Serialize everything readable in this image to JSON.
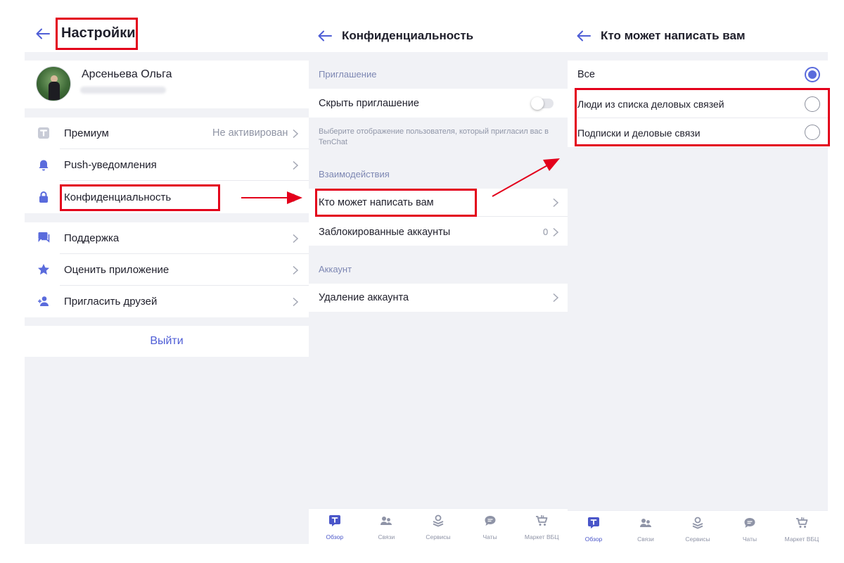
{
  "colors": {
    "accent": "#5a6bdc",
    "highlight": "#e3001b",
    "section": "#7d87b3",
    "background": "#f1f2f6"
  },
  "settings": {
    "title": "Настройки",
    "profile": {
      "name": "Арсеньева Ольга"
    },
    "items": [
      {
        "label": "Премиум",
        "value": "Не активирован",
        "icon": "premium-t-icon"
      },
      {
        "label": "Push-уведомления",
        "icon": "bell-icon"
      },
      {
        "label": "Конфиденциальность",
        "icon": "lock-icon"
      },
      {
        "label": "Поддержка",
        "icon": "chat-icon"
      },
      {
        "label": "Оценить приложение",
        "icon": "star-icon"
      },
      {
        "label": "Пригласить друзей",
        "icon": "add-person-icon"
      }
    ],
    "logout": "Выйти"
  },
  "privacy": {
    "title": "Конфиденциальность",
    "section_invite": "Приглашение",
    "hide_invite": "Скрыть приглашение",
    "hide_invite_note": "Выберите отображение пользователя, который пригласил вас в TenChat",
    "section_interaction": "Взаимодействия",
    "who_can_write": "Кто может написать вам",
    "blocked": "Заблокированные аккаунты",
    "blocked_count": "0",
    "section_account": "Аккаунт",
    "delete_account": "Удаление аккаунта"
  },
  "who": {
    "title": "Кто может написать вам",
    "options": [
      {
        "label": "Все",
        "selected": true
      },
      {
        "label": "Люди из списка деловых связей",
        "selected": false
      },
      {
        "label": "Подписки и деловые связи",
        "selected": false
      }
    ]
  },
  "tabbar": [
    {
      "label": "Обзор",
      "icon": "overview-t-icon",
      "active": true
    },
    {
      "label": "Связи",
      "icon": "people-icon"
    },
    {
      "label": "Сервисы",
      "icon": "services-icon"
    },
    {
      "label": "Чаты",
      "icon": "chats-icon"
    },
    {
      "label": "Маркет ВБЦ",
      "icon": "cart-icon"
    }
  ]
}
